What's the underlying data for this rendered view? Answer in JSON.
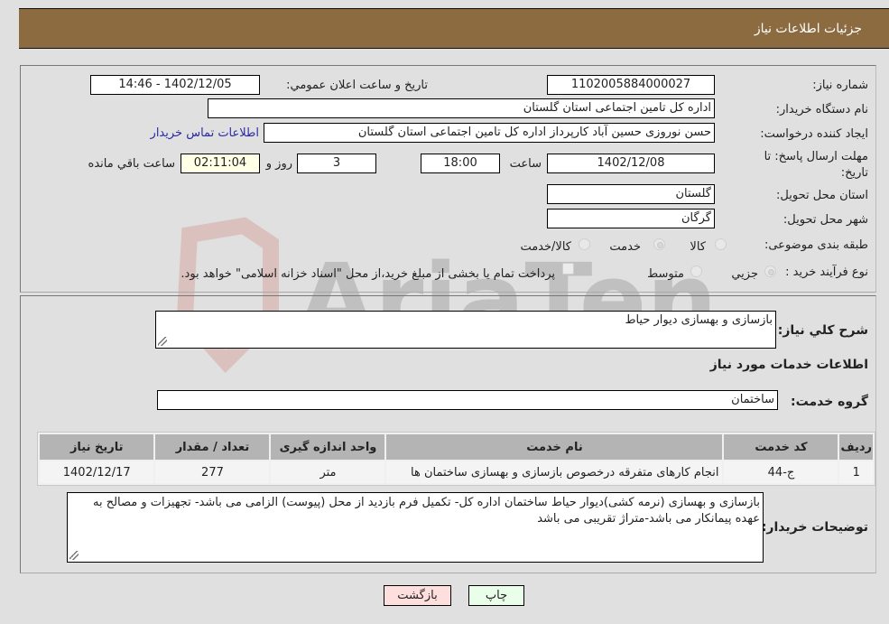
{
  "header": {
    "title": "جزئیات اطلاعات نیاز"
  },
  "fields": {
    "need_number": {
      "label": "شماره نیاز:",
      "value": "1102005884000027"
    },
    "announce_datetime": {
      "label": "تاریخ و ساعت اعلان عمومي:",
      "value": "1402/12/05 - 14:46"
    },
    "buyer_org": {
      "label": "نام دستگاه خریدار:",
      "value": "اداره کل تامین اجتماعی استان گلستان"
    },
    "requester": {
      "label": "ایجاد کننده درخواست:",
      "value": "حسن نوروزی حسین آباد کارپرداز اداره کل تامین اجتماعی استان گلستان"
    },
    "buyer_contact_link": "اطلاعات تماس خریدار",
    "deadline": {
      "label": "مهلت ارسال پاسخ: تا تاریخ:",
      "date": "1402/12/08",
      "time_label": "ساعت",
      "time": "18:00",
      "days": "3",
      "days_label": "روز و",
      "remaining": "02:11:04",
      "remaining_label": "ساعت باقي مانده"
    },
    "province": {
      "label": "استان محل تحویل:",
      "value": "گلستان"
    },
    "city": {
      "label": "شهر محل تحویل:",
      "value": "گرگان"
    },
    "category": {
      "label": "طبقه بندی موضوعی:",
      "options": [
        "کالا",
        "خدمت",
        "کالا/خدمت"
      ],
      "selected": "خدمت"
    },
    "purchase_type": {
      "label": "نوع فرآیند خرید :",
      "options": [
        "جزيي",
        "متوسط"
      ],
      "selected": "جزيي",
      "treasury_note": "پرداخت تمام یا بخشی از مبلغ خرید،از محل \"اسناد خزانه اسلامی\" خواهد بود."
    }
  },
  "summary": {
    "label": "شرح کلي نياز:",
    "value": "بازسازی و بهسازی دیوار حیاط"
  },
  "services_section_title": "اطلاعات خدمات مورد نیاز",
  "service_group": {
    "label": "گروه خدمت:",
    "value": "ساختمان"
  },
  "table": {
    "headers": [
      "ردیف",
      "کد خدمت",
      "نام خدمت",
      "واحد اندازه گیری",
      "تعداد / مقدار",
      "تاریخ نیاز"
    ],
    "rows": [
      [
        "1",
        "ج-44",
        "انجام کارهای متفرقه درخصوص بازسازی و بهسازی ساختمان ها",
        "متر",
        "277",
        "1402/12/17"
      ]
    ]
  },
  "buyer_notes": {
    "label": "توضیحات خریدار:",
    "value": "بازسازی و بهسازی (نرمه کشی)دیوار حیاط ساختمان اداره کل- تکمیل فرم بازدید از محل (پیوست) الزامی می باشد- تجهیزات و مصالح به عهده پیمانکار می باشد-متراژ تقریبی می باشد"
  },
  "buttons": {
    "print": "چاپ",
    "back": "بازگشت"
  },
  "watermark": "AriaTender.neT",
  "colors": {
    "header_bg": "#8d6b41",
    "print_bg": "#eaffea",
    "back_bg": "#ffdede",
    "link": "#2a2aa5"
  }
}
